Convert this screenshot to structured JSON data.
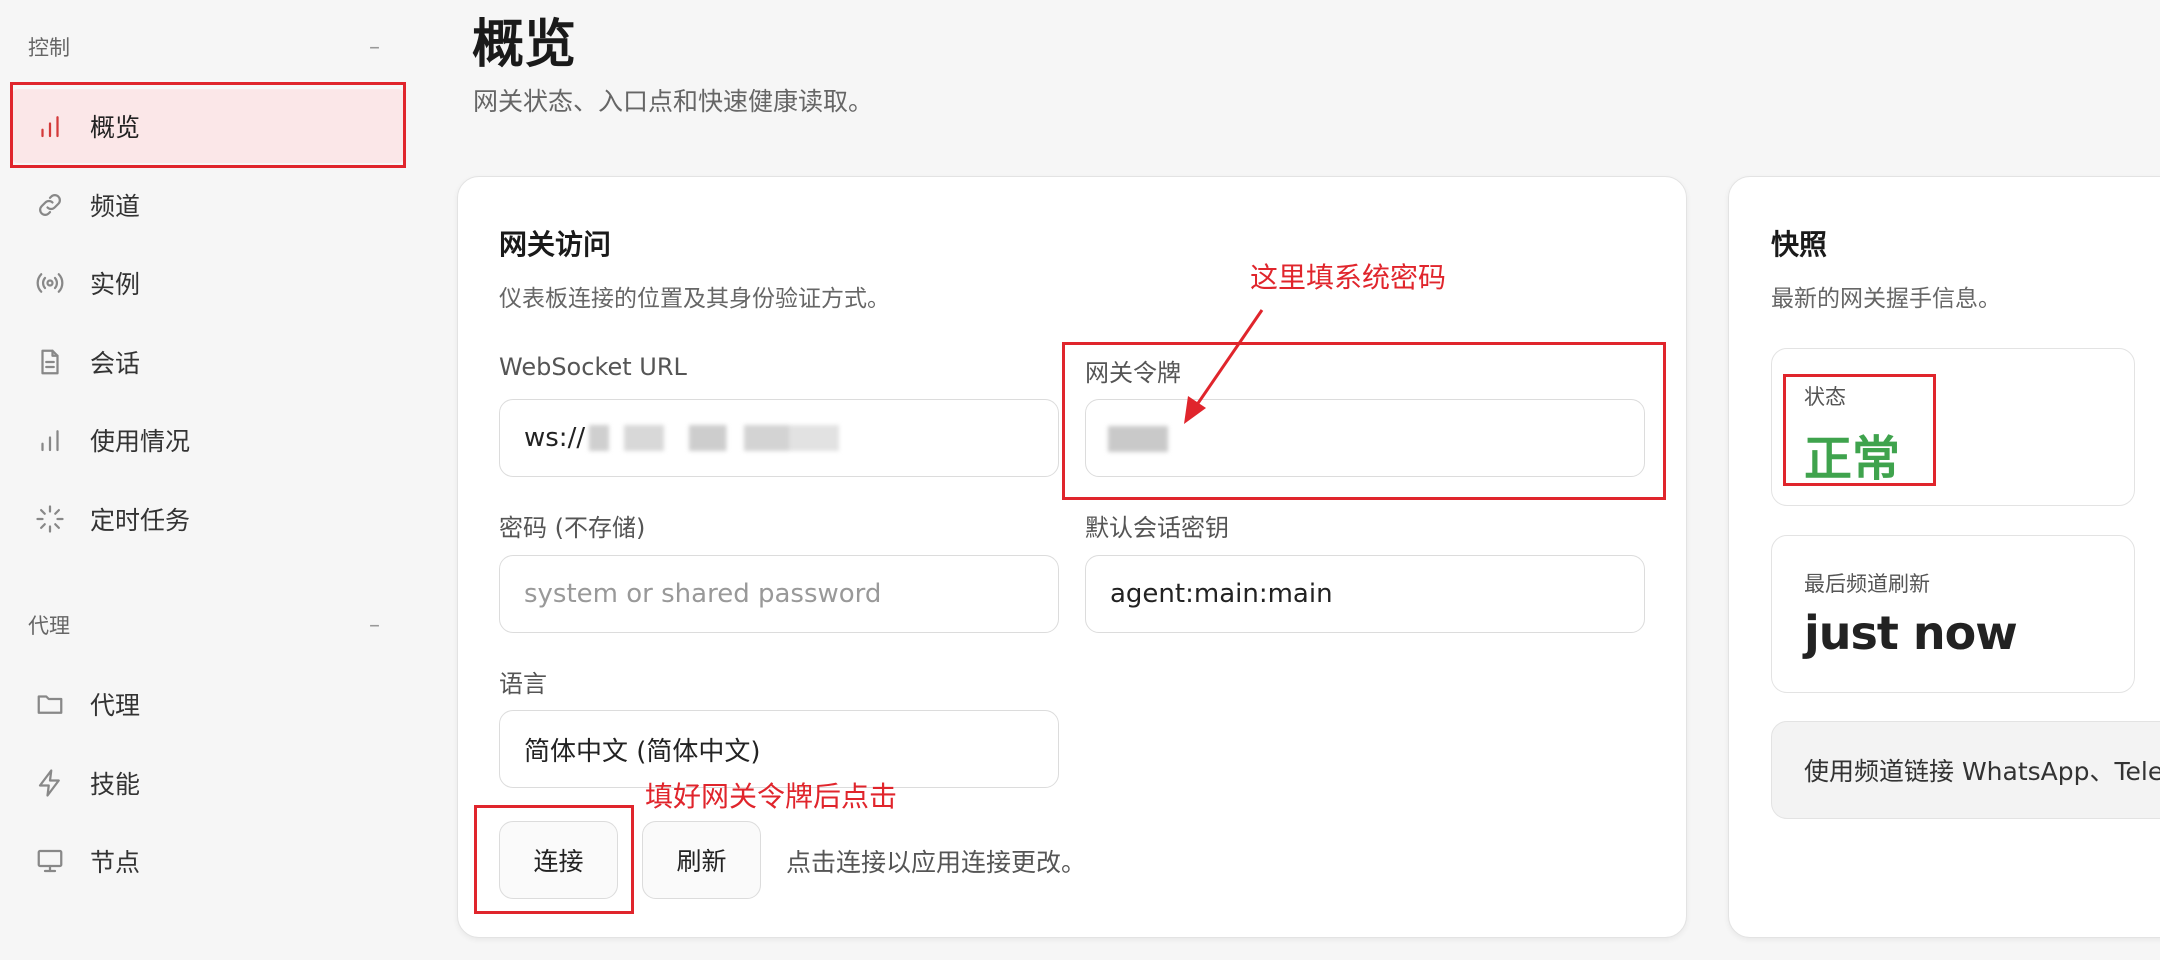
{
  "sidebar": {
    "groups": [
      {
        "title": "控制",
        "collapse": "–"
      },
      {
        "title": "代理",
        "collapse": "–"
      }
    ],
    "control_items": [
      {
        "label": "概览",
        "icon": "bar-chart-icon"
      },
      {
        "label": "频道",
        "icon": "link-icon"
      },
      {
        "label": "实例",
        "icon": "broadcast-icon"
      },
      {
        "label": "会话",
        "icon": "document-icon"
      },
      {
        "label": "使用情况",
        "icon": "bar-chart-icon"
      },
      {
        "label": "定时任务",
        "icon": "spinner-icon"
      }
    ],
    "agent_items": [
      {
        "label": "代理",
        "icon": "folder-icon"
      },
      {
        "label": "技能",
        "icon": "lightning-icon"
      },
      {
        "label": "节点",
        "icon": "monitor-icon"
      }
    ]
  },
  "header": {
    "title": "概览",
    "subtitle": "网关状态、入口点和快速健康读取。"
  },
  "gateway_card": {
    "title": "网关访问",
    "desc": "仪表板连接的位置及其身份验证方式。",
    "ws_url_label": "WebSocket URL",
    "ws_url_value": "ws://",
    "token_label": "网关令牌",
    "password_label": "密码 (不存储)",
    "password_placeholder": "system or shared password",
    "session_key_label": "默认会话密钥",
    "session_key_value": "agent:main:main",
    "language_label": "语言",
    "language_value": "简体中文 (简体中文)",
    "connect_button": "连接",
    "refresh_button": "刷新",
    "hint": "点击连接以应用连接更改。"
  },
  "snapshot_card": {
    "title": "快照",
    "desc": "最新的网关握手信息。",
    "status_label": "状态",
    "status_value": "正常",
    "last_refresh_label": "最后频道刷新",
    "last_refresh_value": "just now",
    "info_text": "使用频道链接 WhatsApp、Tele"
  },
  "annotations": {
    "token_note": "这里填系统密码",
    "connect_note": "填好网关令牌后点击"
  },
  "colors": {
    "accent_red": "#e0252c",
    "status_green": "#3fa34d",
    "active_bg": "#fbe7e8"
  }
}
